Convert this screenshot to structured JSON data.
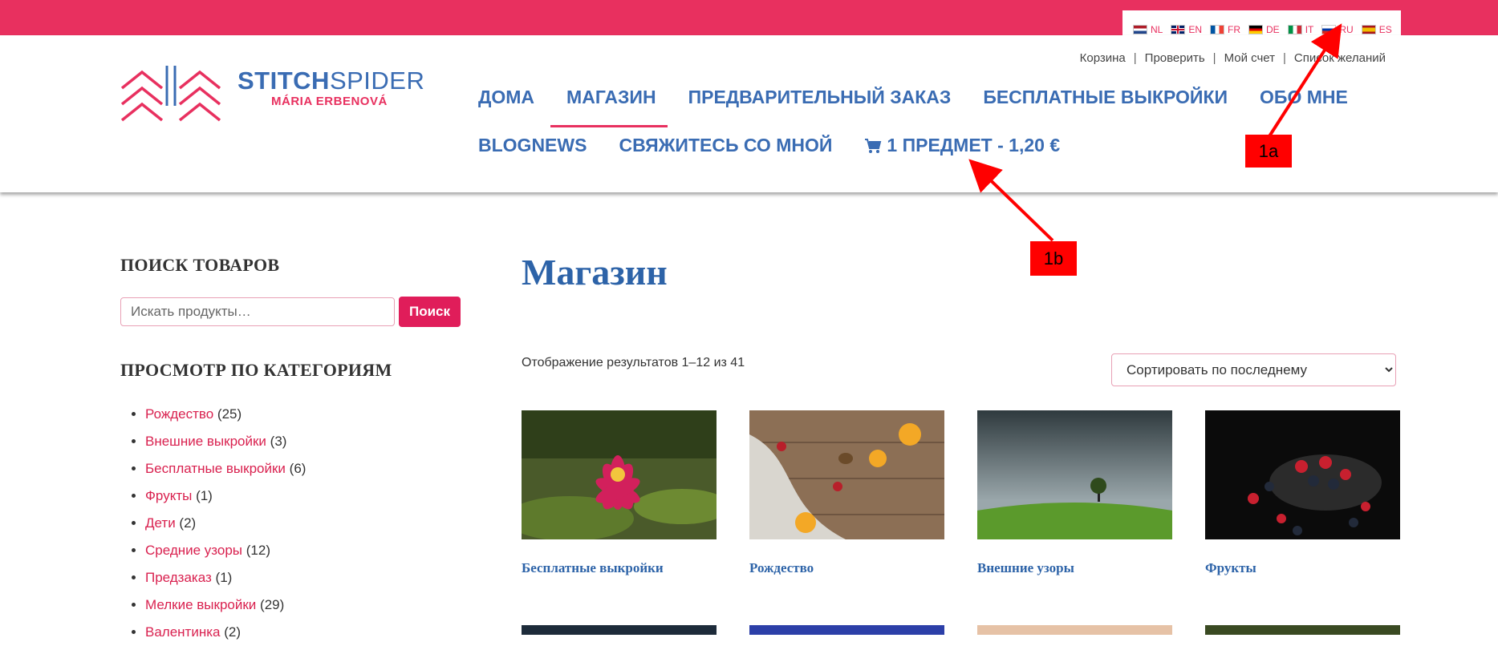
{
  "languages": [
    {
      "code": "NL",
      "flag": "nl"
    },
    {
      "code": "EN",
      "flag": "en"
    },
    {
      "code": "FR",
      "flag": "fr"
    },
    {
      "code": "DE",
      "flag": "de"
    },
    {
      "code": "IT",
      "flag": "it"
    },
    {
      "code": "RU",
      "flag": "ru"
    },
    {
      "code": "ES",
      "flag": "es"
    }
  ],
  "logo": {
    "brand_bold": "STITCH",
    "brand_thin": "SPIDER",
    "subtitle": "MÁRIA ERBENOVÁ"
  },
  "top_links": [
    "Корзина",
    "Проверить",
    "Мой счет",
    "Список желаний"
  ],
  "nav": {
    "row1": [
      "ДОМА",
      "МАГАЗИН",
      "ПРЕДВАРИТЕЛЬНЫЙ ЗАКАЗ",
      "БЕСПЛАТНЫЕ ВЫКРОЙКИ",
      "ОБО МНЕ"
    ],
    "row2": [
      "BLOGNEWS",
      "СВЯЖИТЕСЬ СО МНОЙ"
    ],
    "cart": "1 ПРЕДМЕТ - 1,20 €",
    "active": "МАГАЗИН"
  },
  "annotations": {
    "a": "1a",
    "b": "1b"
  },
  "sidebar": {
    "search_heading": "ПОИСК ТОВАРОВ",
    "search_placeholder": "Искать продукты…",
    "search_button": "Поиск",
    "categories_heading": "ПРОСМОТР ПО КАТЕГОРИЯМ",
    "categories": [
      {
        "name": "Рождество",
        "count": "(25)"
      },
      {
        "name": "Внешние выкройки",
        "count": "(3)"
      },
      {
        "name": "Бесплатные выкройки",
        "count": "(6)"
      },
      {
        "name": "Фрукты",
        "count": "(1)"
      },
      {
        "name": "Дети",
        "count": "(2)"
      },
      {
        "name": "Средние узоры",
        "count": "(12)"
      },
      {
        "name": "Предзаказ",
        "count": "(1)"
      },
      {
        "name": "Мелкие выкройки",
        "count": "(29)"
      },
      {
        "name": "Валентинка",
        "count": "(2)"
      }
    ]
  },
  "main": {
    "title": "Магазин",
    "results": "Отображение результатов 1–12 из 41",
    "sort_selected": "Сортировать по последнему",
    "products": [
      {
        "title": "Бесплатные выкройки"
      },
      {
        "title": "Рождество"
      },
      {
        "title": "Внешние узоры"
      },
      {
        "title": "Фрукты"
      }
    ]
  },
  "colors": {
    "accent": "#e8305f",
    "brand_blue": "#3a6cb3",
    "link_red": "#d9214f"
  }
}
